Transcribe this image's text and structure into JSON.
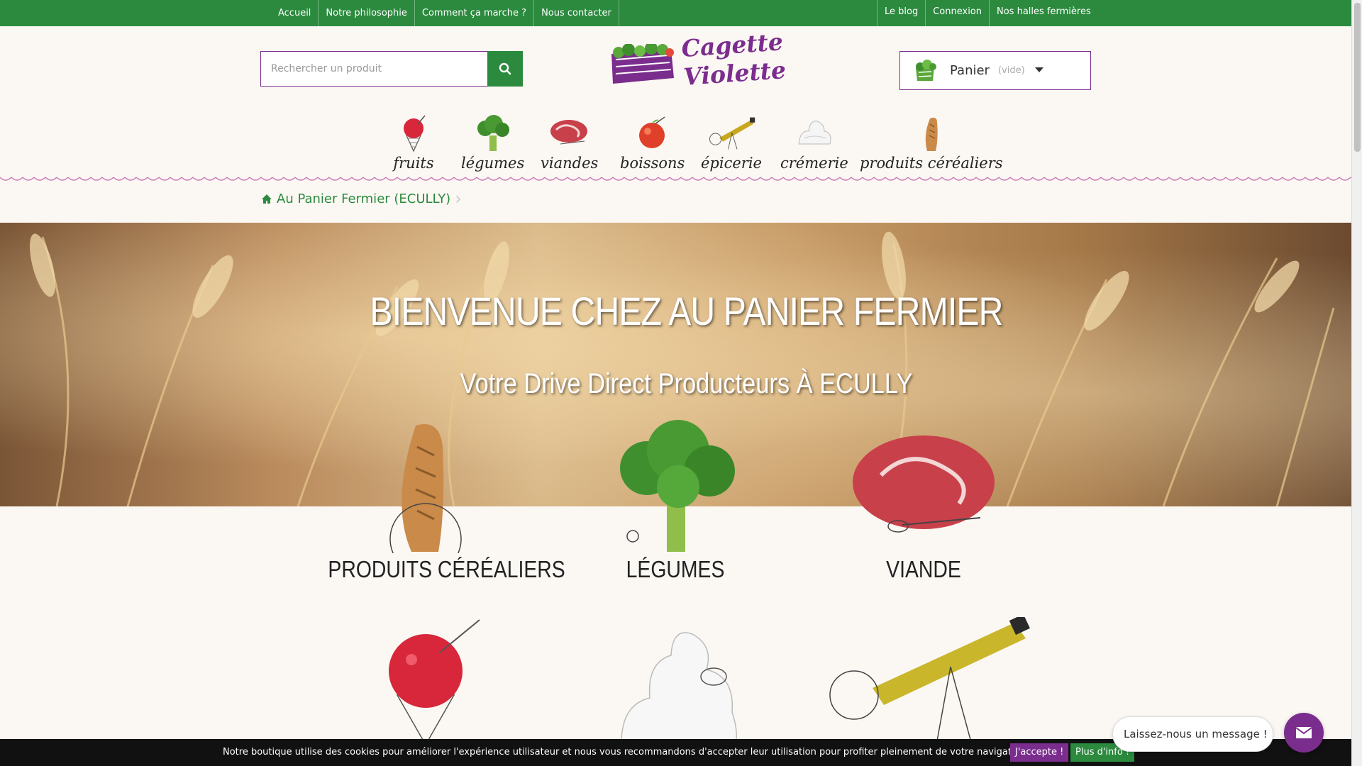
{
  "top_nav": {
    "left": [
      "Accueil",
      "Notre philosophie",
      "Comment ça marche ?",
      "Nous contacter"
    ],
    "right": [
      "Le blog",
      "Connexion",
      "Nos halles fermières"
    ]
  },
  "search": {
    "placeholder": "Rechercher un produit",
    "icon": "search-icon"
  },
  "logo": {
    "line1": "Cagette",
    "line2": "Violette"
  },
  "cart": {
    "label": "Panier",
    "status": "(vide)"
  },
  "categories": [
    "fruits",
    "légumes",
    "viandes",
    "boissons",
    "épicerie",
    "crémerie",
    "produits céréaliers"
  ],
  "breadcrumb": {
    "label": "Au Panier Fermier (ECULLY)"
  },
  "hero": {
    "title": "BIENVENUE CHEZ AU PANIER FERMIER",
    "subtitle": "Votre Drive Direct Producteurs À ECULLY"
  },
  "tiles": [
    "PRODUITS CÉRÉALIERS",
    "LÉGUMES",
    "VIANDE"
  ],
  "cookie": {
    "message": "Notre boutique utilise des cookies pour améliorer l'expérience utilisateur et nous vous recommandons d'accepter leur utilisation pour profiter pleinement de votre navigation.",
    "accept": "J'accepte !",
    "more": "Plus d'info !"
  },
  "chat": {
    "message": "Laissez-nous un message !"
  },
  "colors": {
    "green": "#2b8a3e",
    "purple": "#7b2d8e",
    "cream": "#fbf7f3"
  }
}
